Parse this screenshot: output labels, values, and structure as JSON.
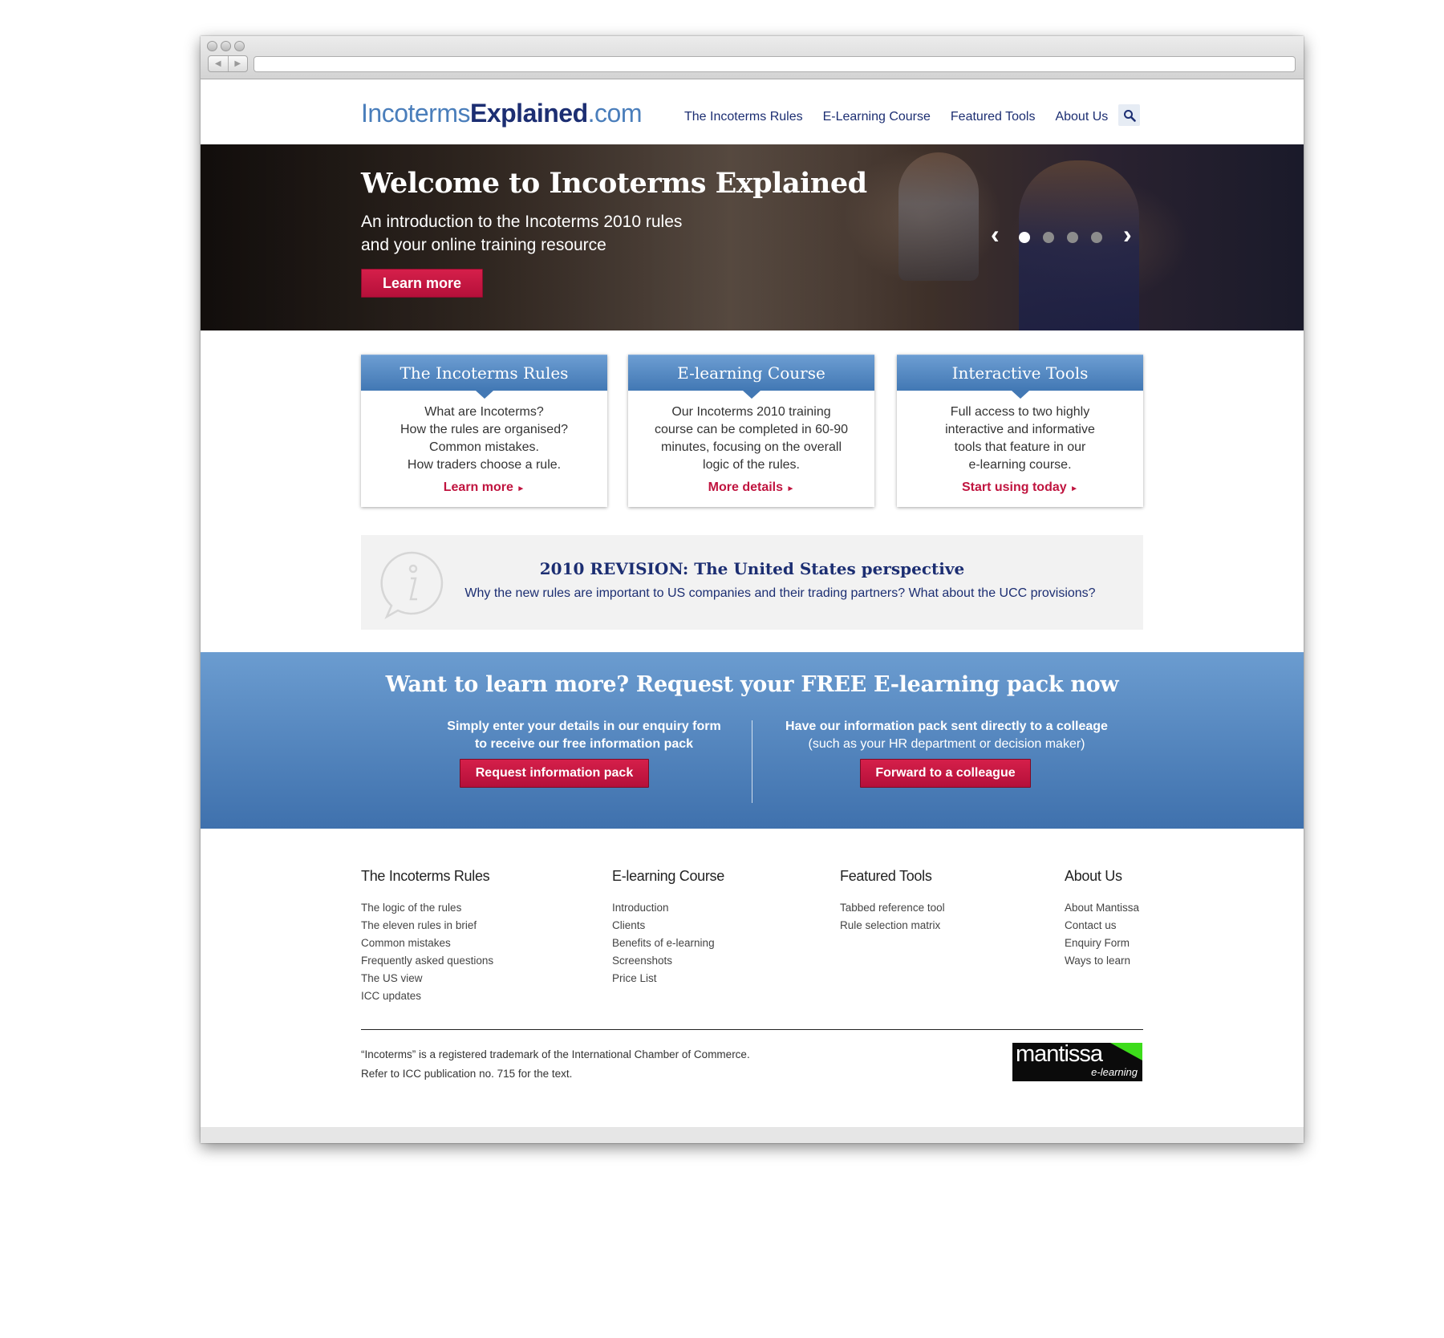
{
  "header": {
    "logo": {
      "part1": "Incoterms",
      "part2": "Explained",
      "part3": ".com"
    },
    "nav": [
      "The Incoterms Rules",
      "E-Learning Course",
      "Featured Tools",
      "About Us"
    ]
  },
  "hero": {
    "title": "Welcome to Incoterms Explained",
    "subtitle_line1": "An introduction to the Incoterms 2010 rules",
    "subtitle_line2": "and your online training resource",
    "button": "Learn more",
    "slide_count": 4,
    "active_slide": 1
  },
  "cards": [
    {
      "title": "The Incoterms Rules",
      "lines": [
        "What are Incoterms?",
        "How the rules are organised?",
        "Common mistakes.",
        "How traders choose a rule."
      ],
      "link": "Learn more"
    },
    {
      "title": "E-learning Course",
      "lines": [
        "Our Incoterms 2010 training",
        "course can be completed in 60-90",
        "minutes, focusing on the overall",
        "logic of the rules."
      ],
      "link": "More details"
    },
    {
      "title": "Interactive Tools",
      "lines": [
        "Full access to two highly",
        "interactive and informative",
        "tools that feature in our",
        "e-learning course."
      ],
      "link": "Start using today"
    }
  ],
  "info": {
    "title": "2010 REVISION: The United States perspective",
    "text": "Why the new rules are important to US companies and their trading partners? What about the UCC provisions?"
  },
  "band": {
    "title": "Want to learn more? Request your FREE E-learning pack now",
    "left_line1": "Simply enter your details in our enquiry form",
    "left_line2": "to receive our free information pack",
    "left_button": "Request information pack",
    "right_line1": "Have our information pack sent directly to a colleage",
    "right_line2": "(such as your HR department or decision maker)",
    "right_button": "Forward to a colleague"
  },
  "footer": {
    "columns": [
      {
        "title": "The Incoterms Rules",
        "links": [
          "The logic of the rules",
          "The eleven rules in brief",
          "Common mistakes",
          "Frequently asked questions",
          "The US view",
          "ICC updates"
        ]
      },
      {
        "title": "E-learning Course",
        "links": [
          "Introduction",
          "Clients",
          "Benefits of e-learning",
          "Screenshots",
          "Price List"
        ]
      },
      {
        "title": "Featured Tools",
        "links": [
          "Tabbed reference tool",
          "Rule selection matrix"
        ]
      },
      {
        "title": "About Us",
        "links": [
          "About Mantissa",
          "Contact us",
          "Enquiry Form",
          "Ways to learn"
        ]
      }
    ],
    "legal_line1": "“Incoterms” is a registered trademark of the International Chamber of Commerce.",
    "legal_line2": "Refer to ICC publication no. 715 for the text.",
    "partner_logo": {
      "name": "mantissa",
      "tagline": "e-learning"
    }
  },
  "colors": {
    "brand_dark": "#1c2e72",
    "brand_light": "#4a7ebb",
    "accent_red": "#c0143f",
    "band_blue": "#4f82bd"
  }
}
